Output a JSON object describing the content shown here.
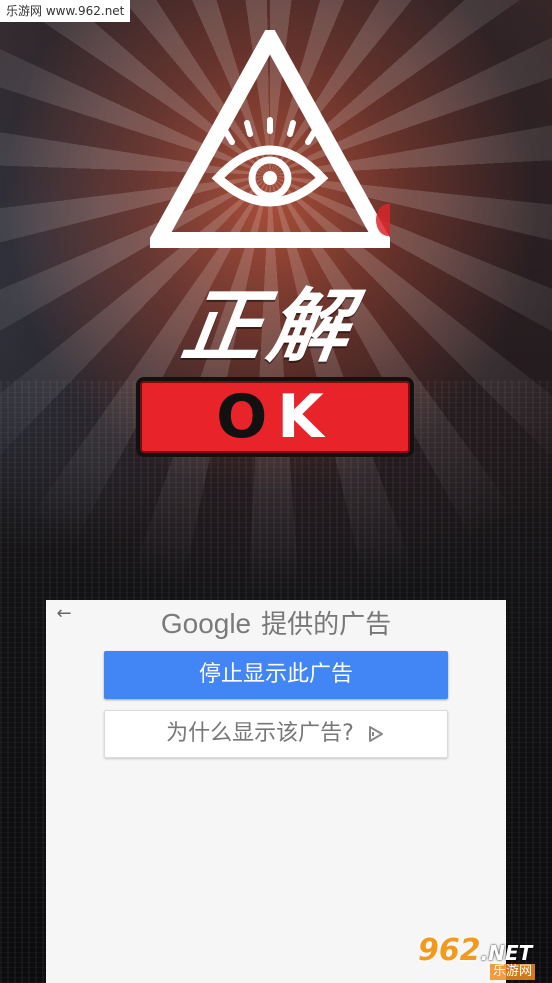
{
  "watermark_top": "乐游网 www.962.net",
  "title": "正解",
  "ok_button": {
    "letter_o": "O",
    "letter_k": "K"
  },
  "ad": {
    "back_icon": "←",
    "google": "Google",
    "offered_by": "提供的广告",
    "stop_button": "停止显示此广告",
    "why_button": "为什么显示该广告?"
  },
  "watermark_bottom": {
    "brand": "962",
    "suffix": ".NET",
    "site": "乐游网"
  },
  "colors": {
    "ok_red": "#e8232a",
    "ad_blue": "#4285f4",
    "watermark_orange": "#f39a1e"
  },
  "icons": [
    "eye-of-providence-icon",
    "back-arrow-icon",
    "adchoices-icon"
  ]
}
